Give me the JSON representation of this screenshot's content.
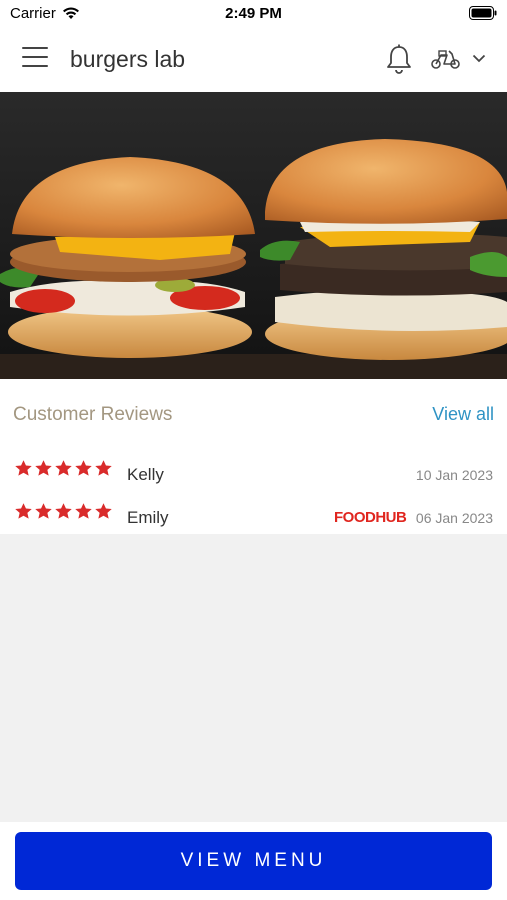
{
  "status_bar": {
    "carrier": "Carrier",
    "time": "2:49 PM"
  },
  "header": {
    "title": "burgers lab",
    "icons": [
      "menu-icon",
      "bell-icon",
      "scooter-icon",
      "chevron-down-icon"
    ]
  },
  "reviews": {
    "heading": "Customer Reviews",
    "view_all": "View all",
    "items": [
      {
        "name": "Kelly",
        "rating": 5,
        "date": "10 Jan 2023",
        "source": ""
      },
      {
        "name": "Emily",
        "rating": 5,
        "date": "06 Jan 2023",
        "source": "FOODHUB"
      }
    ]
  },
  "footer": {
    "button_label": "VIEW MENU"
  },
  "colors": {
    "accent": "#0028d6",
    "link": "#2f93c4",
    "star": "#d92b2b",
    "heading": "#a39781",
    "brand_foodhub": "#e0261f"
  }
}
